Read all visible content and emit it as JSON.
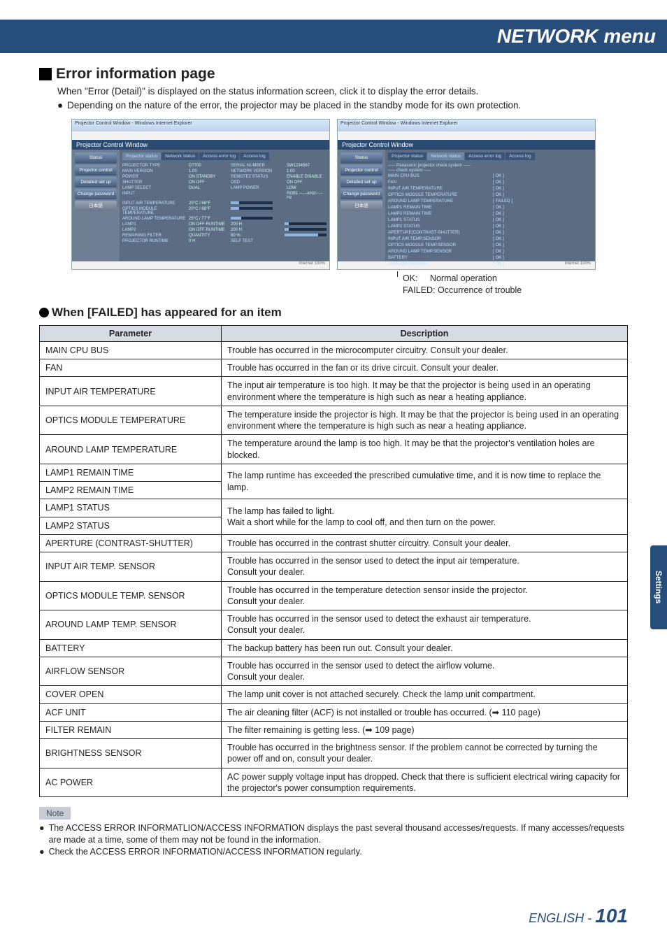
{
  "header": {
    "title": "NETWORK menu"
  },
  "section": {
    "title": "Error information page",
    "intro": "When \"Error (Detail)\" is displayed on the status information screen, click it to display the error details.",
    "bullet": "Depending on the nature of the error, the projector may be placed in the standby mode for its own protection."
  },
  "screenshots": {
    "browser_title": "Projector Control Window - Windows Internet Explorer",
    "window_title": "Projector Control Window",
    "nav": {
      "status": "Status",
      "projector_control": "Projector control",
      "detailed_setup": "Detailed set up",
      "change_password": "Change password",
      "japanese": "日本語"
    },
    "tabs": {
      "projector_status": "Projector status",
      "network_status": "Network status",
      "access_error_log": "Access error log",
      "access_log": "Access log"
    },
    "left": {
      "rows": [
        {
          "l1": "PROJECTOR TYPE",
          "v1": "D7700",
          "l2": "SERIAL NUMBER",
          "v2": "SW1234567"
        },
        {
          "l1": "MAIN VERSION",
          "v1": "1.00",
          "l2": "NETWORK VERSION",
          "v2": "1.00"
        },
        {
          "l1": "POWER",
          "v1": "ON   STANDBY",
          "l2": "REMOTE2 STATUS",
          "v2": "ENABLE   DISABLE"
        },
        {
          "l1": "SHUTTER",
          "v1": "ON   OFF",
          "l2": "OSD",
          "v2": "ON   OFF"
        },
        {
          "l1": "LAMP SELECT",
          "v1": "DUAL",
          "l2": "LAMP POWER",
          "v2": "LOW"
        },
        {
          "l1": "INPUT",
          "v1": "",
          "l2": "",
          "v2": "RGB1    ---,--kHz/--.--Hz"
        },
        {
          "l1": "INPUT AIR TEMPERATURE",
          "v1": "20°C / 68°F",
          "bar": 20
        },
        {
          "l1": "OPTICS MODULE TEMPERATURE",
          "v1": "20°C / 68°F",
          "bar": 20
        },
        {
          "l1": "AROUND LAMP TEMPERATURE",
          "v1": "25°C / 77°F",
          "bar": 25
        },
        {
          "l1": "LAMP1",
          "v1": "ON   OFF   RUNTIME",
          "v2": "200 H",
          "bar": 10
        },
        {
          "l1": "LAMP2",
          "v1": "ON   OFF   RUNTIME",
          "v2": "200 H",
          "bar": 10
        },
        {
          "l1": "REMAINING FILTER",
          "v1": "QUANTITY",
          "v2": "80 %",
          "bar": 80
        },
        {
          "l1": "PROJECTOR RUNTIME",
          "v1": "0 H",
          "l2": "SELF TEST"
        }
      ]
    },
    "right": {
      "header": "----- Panasonic projector check system -----",
      "sub": "----- check system -----",
      "items": [
        {
          "name": "MAIN CPU BUS",
          "val": "[ OK ]"
        },
        {
          "name": "FAN",
          "val": "[ OK ]"
        },
        {
          "name": "INPUT AIR TEMPERATURE",
          "val": "[ OK ]"
        },
        {
          "name": "OPTICS MODULE TEMPERATURE",
          "val": "[ OK ]"
        },
        {
          "name": "AROUND LAMP TEMPERATURE",
          "val": "[ FAILED ]"
        },
        {
          "name": "LAMP1 REMAIN TIME",
          "val": "[ OK ]"
        },
        {
          "name": "LAMP2 REMAIN TIME",
          "val": "[ OK ]"
        },
        {
          "name": "LAMP1 STATUS",
          "val": "[ OK ]"
        },
        {
          "name": "LAMP2 STATUS",
          "val": "[ OK ]"
        },
        {
          "name": "APERTURE(CONTRAST-SHUTTER)",
          "val": "[ OK ]"
        },
        {
          "name": "INPUT AIR TEMP.SENSOR",
          "val": "[ OK ]"
        },
        {
          "name": "OPTICS MODULE TEMP.SENSOR",
          "val": "[ OK ]"
        },
        {
          "name": "AROUND LAMP TEMP.SENSOR",
          "val": "[ OK ]"
        },
        {
          "name": "BATTERY",
          "val": "[ OK ]"
        },
        {
          "name": "AIRFLOW SENSOR",
          "val": "[ OK ]"
        }
      ]
    },
    "footer_text": "Internet   100%"
  },
  "legend": {
    "ok_label": "OK:",
    "ok_text": "Normal operation",
    "failed_label": "FAILED:",
    "failed_text": "Occurrence of trouble"
  },
  "table": {
    "title": "When [FAILED] has appeared for an item",
    "headers": {
      "param": "Parameter",
      "desc": "Description"
    },
    "rows": [
      {
        "param": "MAIN CPU BUS",
        "desc": "Trouble has occurred in the microcomputer circuitry. Consult your dealer."
      },
      {
        "param": "FAN",
        "desc": "Trouble has occurred in the fan or its drive circuit. Consult your dealer."
      },
      {
        "param": "INPUT AIR TEMPERATURE",
        "desc": "The input air temperature is too high. It may be that the projector is being used in an operating environment where the temperature is high such as near a heating appliance."
      },
      {
        "param": "OPTICS MODULE TEMPERATURE",
        "desc": "The temperature inside the projector is high. It may be that the projector is being used in an operating environment where the temperature is high such as near a heating appliance."
      },
      {
        "param": "AROUND LAMP TEMPERATURE",
        "desc": "The temperature around the lamp is too high. It may be that the projector's ventilation holes are blocked."
      },
      {
        "param": "LAMP1 REMAIN TIME",
        "desc": "The lamp runtime has exceeded the prescribed cumulative time, and it is now time to replace the lamp.",
        "merge_down": true
      },
      {
        "param": "LAMP2 REMAIN TIME",
        "merge_up": true
      },
      {
        "param": "LAMP1 STATUS",
        "desc": "The lamp has failed to light.\nWait a short while for the lamp to cool off, and then turn on the power.",
        "merge_down": true
      },
      {
        "param": "LAMP2 STATUS",
        "merge_up": true
      },
      {
        "param": "APERTURE (CONTRAST-SHUTTER)",
        "desc": "Trouble has occurred in the contrast shutter circuitry. Consult your dealer."
      },
      {
        "param": "INPUT AIR TEMP. SENSOR",
        "desc": "Trouble has occurred in the sensor used to detect the input air temperature.\nConsult your dealer."
      },
      {
        "param": "OPTICS MODULE TEMP. SENSOR",
        "desc": "Trouble has occurred in the temperature detection sensor inside the projector.\nConsult your dealer."
      },
      {
        "param": "AROUND LAMP TEMP. SENSOR",
        "desc": "Trouble has occurred in the sensor used to detect the exhaust air temperature.\nConsult your dealer."
      },
      {
        "param": "BATTERY",
        "desc": "The backup battery has been run out. Consult your dealer."
      },
      {
        "param": "AIRFLOW SENSOR",
        "desc": "Trouble has occurred in the sensor used to detect the airflow volume.\nConsult your dealer."
      },
      {
        "param": "COVER OPEN",
        "desc": "The lamp unit cover is not attached securely. Check the lamp unit compartment."
      },
      {
        "param": "ACF UNIT",
        "desc": "The air cleaning filter (ACF) is not installed or trouble has occurred. (➡ 110 page)"
      },
      {
        "param": "FILTER REMAIN",
        "desc": "The filter remaining is getting less. (➡ 109 page)"
      },
      {
        "param": "BRIGHTNESS SENSOR",
        "desc": "Trouble has occurred in the brightness sensor. If the problem cannot be corrected by turning the power off and on, consult your dealer."
      },
      {
        "param": "AC POWER",
        "desc": "AC power supply voltage input has dropped. Check that there is sufficient electrical wiring capacity for the projector's power consumption requirements."
      }
    ]
  },
  "notes": {
    "label": "Note",
    "items": [
      "The ACCESS ERROR INFORMATLION/ACCESS INFORMATION displays the past several thousand accesses/requests. If many accesses/requests are made at a time, some of them may not be found in the information.",
      "Check the ACCESS ERROR INFORMATION/ACCESS INFORMATION regularly."
    ]
  },
  "side_tab": "Settings",
  "footer": {
    "lang": "ENGLISH",
    "sep": " - ",
    "page": "101"
  }
}
